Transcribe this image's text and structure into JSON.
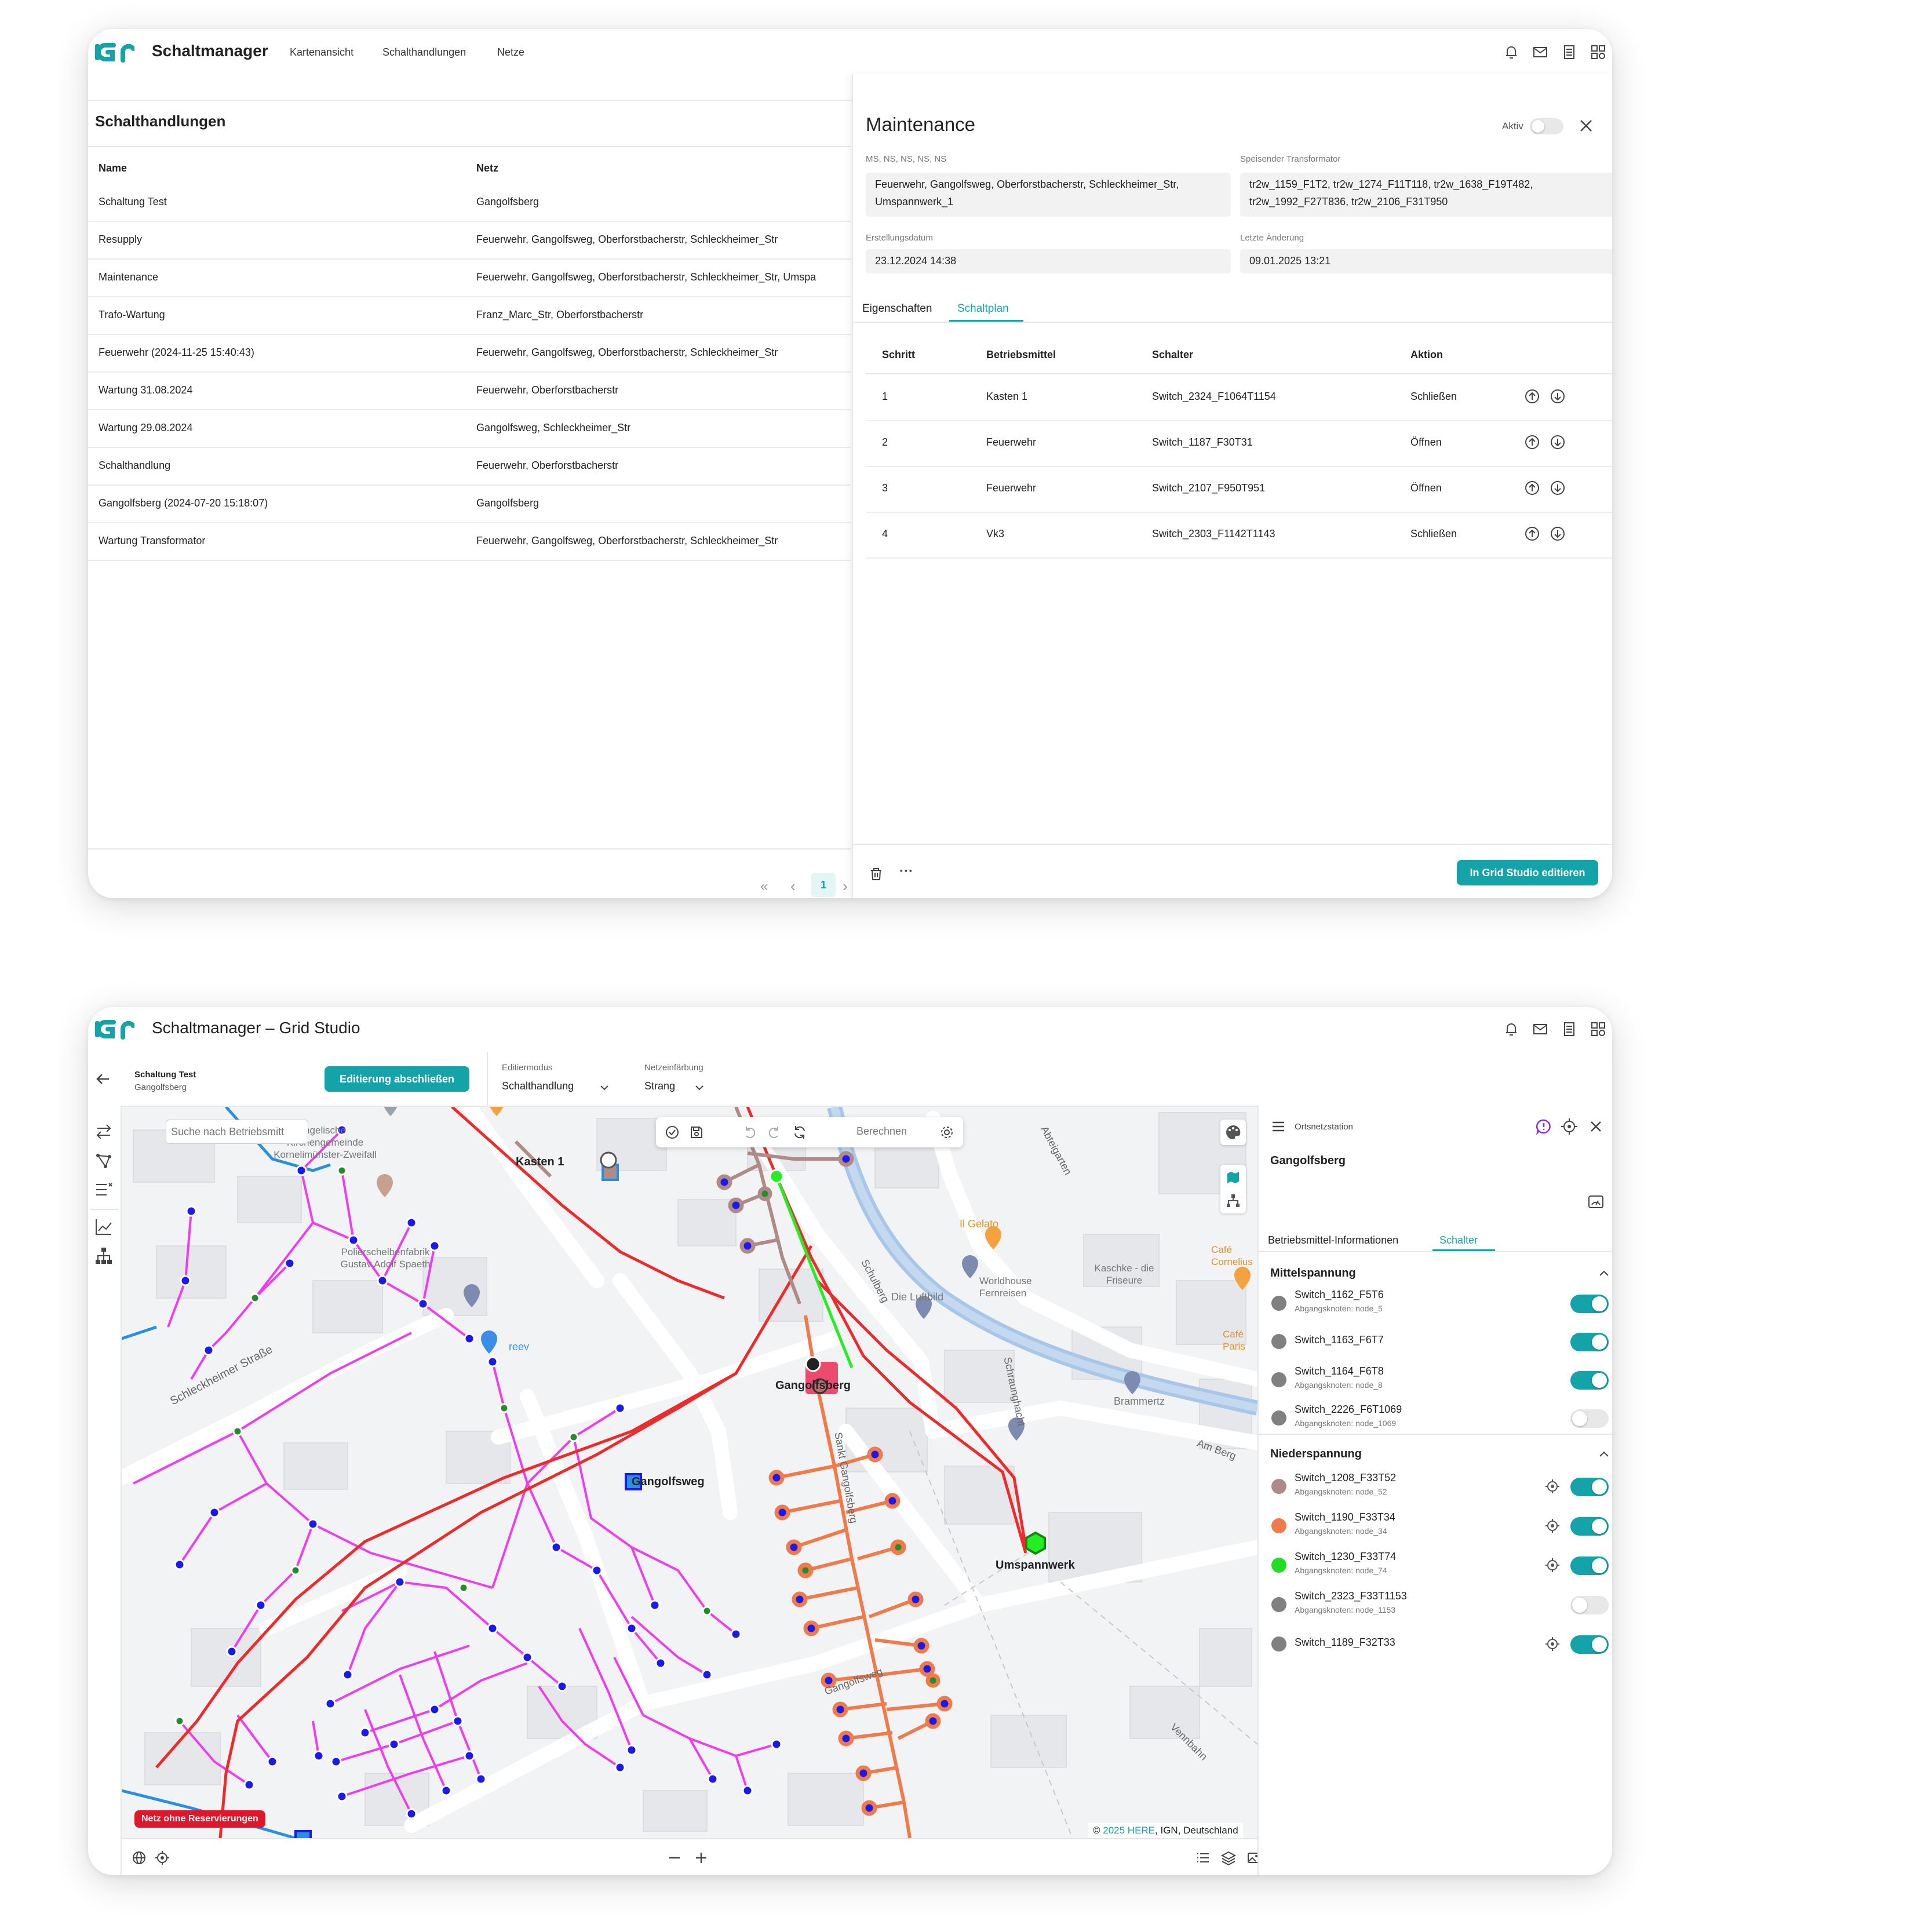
{
  "win1": {
    "header": {
      "title": "Schaltmanager",
      "nav": [
        "Kartenansicht",
        "Schalthandlungen",
        "Netze"
      ]
    },
    "list": {
      "heading": "Schalthandlungen",
      "columns": [
        "Name",
        "Netz"
      ],
      "rows": [
        {
          "name": "Schaltung Test",
          "netz": "Gangolfsberg"
        },
        {
          "name": "Resupply",
          "netz": "Feuerwehr, Gangolfsweg, Oberforstbacherstr, Schleckheimer_Str"
        },
        {
          "name": "Maintenance",
          "netz": "Feuerwehr, Gangolfsweg, Oberforstbacherstr, Schleckheimer_Str, Umspa"
        },
        {
          "name": "Trafo-Wartung",
          "netz": "Franz_Marc_Str, Oberforstbacherstr"
        },
        {
          "name": "Feuerwehr (2024-11-25 15:40:43)",
          "netz": "Feuerwehr, Gangolfsweg, Oberforstbacherstr, Schleckheimer_Str"
        },
        {
          "name": "Wartung 31.08.2024",
          "netz": "Feuerwehr, Oberforstbacherstr"
        },
        {
          "name": "Wartung 29.08.2024",
          "netz": "Gangolfsweg, Schleckheimer_Str"
        },
        {
          "name": "Schalthandlung",
          "netz": "Feuerwehr, Oberforstbacherstr"
        },
        {
          "name": "Gangolfsberg (2024-07-20 15:18:07)",
          "netz": "Gangolfsberg"
        },
        {
          "name": "Wartung Transformator",
          "netz": "Feuerwehr, Gangolfsweg, Oberforstbacherstr, Schleckheimer_Str"
        }
      ],
      "pagination": {
        "first": "«",
        "prev": "‹",
        "page": "1",
        "next": "›"
      }
    },
    "detail": {
      "title": "Maintenance",
      "aktiv_label": "Aktiv",
      "netz_label": "MS, NS, NS, NS, NS",
      "netz_value": [
        "Feuerwehr, Gangolfsweg, Oberforstbacherstr, Schleckheimer_Str,",
        "Umspannwerk_1"
      ],
      "trafo_label": "Speisender Transformator",
      "trafo_value": [
        "tr2w_1159_F1T2, tr2w_1274_F11T118, tr2w_1638_F19T482,",
        "tr2w_1992_F27T836, tr2w_2106_F31T950"
      ],
      "created_label": "Erstellungsdatum",
      "created_value": "23.12.2024 14:38",
      "changed_label": "Letzte Änderung",
      "changed_value": "09.01.2025 13:21",
      "tabs": [
        "Eigenschaften",
        "Schaltplan"
      ],
      "columns": [
        "Schritt",
        "Betriebsmittel",
        "Schalter",
        "Aktion"
      ],
      "steps": [
        {
          "schritt": "1",
          "betriebsmittel": "Kasten 1",
          "schalter": "Switch_2324_F1064T1154",
          "aktion": "Schließen"
        },
        {
          "schritt": "2",
          "betriebsmittel": "Feuerwehr",
          "schalter": "Switch_1187_F30T31",
          "aktion": "Öffnen"
        },
        {
          "schritt": "3",
          "betriebsmittel": "Feuerwehr",
          "schalter": "Switch_2107_F950T951",
          "aktion": "Öffnen"
        },
        {
          "schritt": "4",
          "betriebsmittel": "Vk3",
          "schalter": "Switch_2303_F1142T1143",
          "aktion": "Schließen"
        }
      ],
      "edit_button": "In Grid Studio editieren",
      "more": "···"
    }
  },
  "win2": {
    "header": {
      "title": "Schaltmanager – Grid Studio"
    },
    "toolbar": {
      "project_name": "Schaltung Test",
      "project_net": "Gangolfsberg",
      "finish_button": "Editierung abschließen",
      "mode_label": "Editiermodus",
      "mode_value": "Schalthandlung",
      "color_label": "Netzeinfärbung",
      "color_value": "Strang"
    },
    "map": {
      "search_placeholder": "Suche nach Betriebsmitt",
      "compute_label": "Berechnen",
      "badge": "Netz ohne Reservierungen",
      "copyright_prefix": "© ",
      "copyright_link": "2025 HERE",
      "copyright_rest": ", IGN, Deutschland",
      "labels": {
        "kasten": "Kasten 1",
        "gangolfsberg": "Gangolfsberg",
        "gangolfsweg": "Gangolfsweg",
        "umspannwerk": "Umspannwerk",
        "street_schleck": "Schleckheimer Straße",
        "street_sanktgang": "Sankt Gangolfsberg",
        "street_gangweg": "Gangolfsweg",
        "street_abteig": "Abteigarten",
        "street_schulberg": "Schulberg",
        "street_schraun": "Schraunghacht",
        "street_amberg": "Am Berg",
        "street_vennbahn": "Vennbahn",
        "poi_kirche": "ngelische Kirchengemeinde Kornelimünster-Zweifall",
        "poi_polier": "Polierschelbenfabrik Gustav Adolf Spaeth",
        "poi_reev": "reev",
        "poi_gelato": "Il Gelato",
        "poi_luftbild": "Die Luftbild",
        "poi_worldhouse": "Worldhouse Fernreisen",
        "poi_kaschke": "Kaschke - die Friseure",
        "poi_cafe1": "Café Cornelius",
        "poi_cafe2": "Café Paris",
        "poi_brammertz": "Brammertz"
      }
    },
    "panel": {
      "type": "Ortsnetzstation",
      "name": "Gangolfsberg",
      "tabs": [
        "Betriebsmittel-Informationen",
        "Schalter"
      ],
      "mittel_title": "Mittelspannung",
      "mittel": [
        {
          "name": "Switch_1162_F5T6",
          "sub": "Abgangsknoten: node_5",
          "color": "#808080",
          "on": true
        },
        {
          "name": "Switch_1163_F6T7",
          "sub": "",
          "color": "#808080",
          "on": true
        },
        {
          "name": "Switch_1164_F6T8",
          "sub": "Abgangsknoten: node_8",
          "color": "#808080",
          "on": true
        },
        {
          "name": "Switch_2226_F6T1069",
          "sub": "Abgangsknoten: node_1069",
          "color": "#808080",
          "on": false
        }
      ],
      "nieder_title": "Niederspannung",
      "nieder": [
        {
          "name": "Switch_1208_F33T52",
          "sub": "Abgangsknoten: node_52",
          "color": "#b08a86",
          "on": true
        },
        {
          "name": "Switch_1190_F33T34",
          "sub": "Abgangsknoten: node_34",
          "color": "#f07a4a",
          "on": true
        },
        {
          "name": "Switch_1230_F33T74",
          "sub": "Abgangsknoten: node_74",
          "color": "#22dd22",
          "on": true
        },
        {
          "name": "Switch_2323_F33T1153",
          "sub": "Abgangsknoten: node_1153",
          "color": "#808080",
          "on": false
        },
        {
          "name": "Switch_1189_F32T33",
          "sub": "",
          "color": "#808080",
          "on": true
        }
      ]
    }
  },
  "colors": {
    "accent": "#14a3a8",
    "danger": "#e0162b",
    "text": "#222222",
    "muted": "#777777"
  }
}
